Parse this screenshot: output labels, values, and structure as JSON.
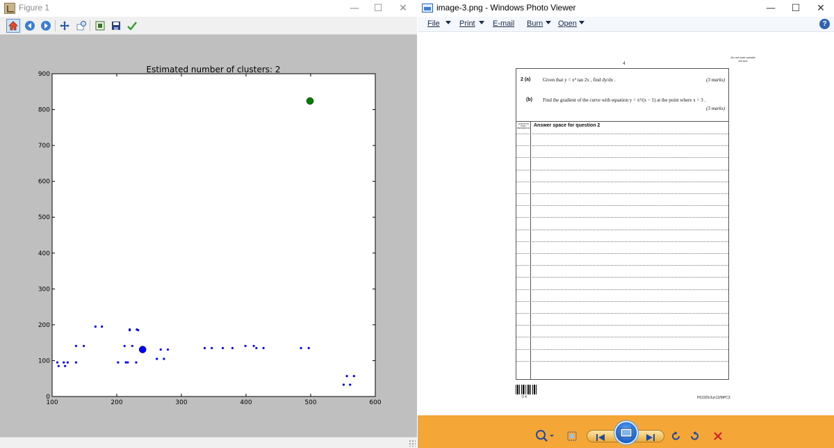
{
  "figure_window": {
    "title": "Figure 1",
    "controls": {
      "minimize": "—",
      "maximize": "☐",
      "close": "✕"
    },
    "toolbar": [
      "home-icon",
      "back-arrow-icon",
      "forward-arrow-icon",
      "pan-icon",
      "zoom-icon",
      "subplots-icon",
      "save-icon",
      "check-icon"
    ]
  },
  "chart_data": {
    "type": "scatter",
    "title": "Estimated number of clusters: 2",
    "xlabel": "",
    "ylabel": "",
    "xlim": [
      100,
      600
    ],
    "ylim": [
      0,
      900
    ],
    "xticks": [
      100,
      200,
      300,
      400,
      500,
      600
    ],
    "yticks": [
      0,
      100,
      200,
      300,
      400,
      500,
      600,
      700,
      800,
      900
    ],
    "grid": false,
    "series": [
      {
        "color": "#0000ff",
        "marker_size": "small",
        "points": [
          [
            108,
            95
          ],
          [
            110,
            85
          ],
          [
            118,
            95
          ],
          [
            120,
            85
          ],
          [
            124,
            95
          ],
          [
            137,
            95
          ],
          [
            137,
            141
          ],
          [
            149,
            141
          ],
          [
            167,
            195
          ],
          [
            177,
            195
          ],
          [
            202,
            95
          ],
          [
            212,
            141
          ],
          [
            214,
            95
          ],
          [
            217,
            95
          ],
          [
            220,
            185
          ],
          [
            220,
            187
          ],
          [
            224,
            141
          ],
          [
            230,
            95
          ],
          [
            231,
            187
          ],
          [
            233,
            185
          ],
          [
            262,
            105
          ],
          [
            268,
            131
          ],
          [
            273,
            105
          ],
          [
            279,
            131
          ],
          [
            336,
            135
          ],
          [
            347,
            135
          ],
          [
            364,
            135
          ],
          [
            379,
            135
          ],
          [
            399,
            141
          ],
          [
            412,
            141
          ],
          [
            416,
            135
          ],
          [
            427,
            135
          ],
          [
            485,
            135
          ],
          [
            497,
            135
          ],
          [
            551,
            33
          ],
          [
            556,
            57
          ],
          [
            561,
            33
          ],
          [
            567,
            57
          ]
        ]
      }
    ],
    "centers": [
      {
        "x": 240,
        "y": 131,
        "color": "#0000ff"
      },
      {
        "x": 499,
        "y": 824,
        "color": "#008000"
      }
    ]
  },
  "photo_viewer": {
    "title": "image-3.png - Windows Photo Viewer",
    "controls": {
      "minimize": "—",
      "maximize": "☐",
      "close": "✕"
    },
    "menu": [
      "File",
      "Print",
      "E-mail",
      "Burn",
      "Open"
    ],
    "menu_with_caret": [
      true,
      true,
      false,
      true,
      true
    ],
    "help": "?"
  },
  "exam_page": {
    "page_number": "4",
    "do_not_write": "Do not write outside the box",
    "q2a_label": "2 (a)",
    "q2a_text": "Given that y = x⁴ tan 2x , find dy/dx .",
    "q2a_marks": "(3 marks)",
    "q2b_label": "(b)",
    "q2b_text": "Find the gradient of the curve with equation y = x²/(x − 1) at the point where x = 3 .",
    "q2b_marks": "(3 marks)",
    "ref_label": "QUESTION PART REFERENCE",
    "answer_heading": "Answer space for question 2",
    "barcode_text": "0  4",
    "footer_code": "P61925/Jun13/MPC3"
  }
}
